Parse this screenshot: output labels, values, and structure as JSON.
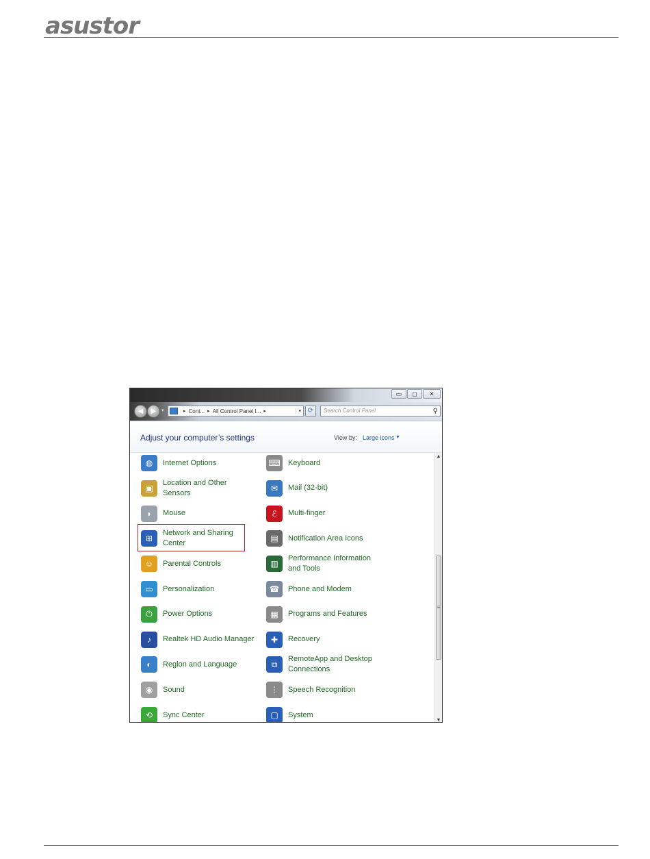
{
  "page": {
    "brand": "asustor"
  },
  "window": {
    "controls": {
      "minimize": "▭",
      "maximize": "◻",
      "close": "✕"
    },
    "toolbar": {
      "back": "◀",
      "forward": "▶",
      "breadcrumb": [
        "Cont...",
        "All Control Panel I..."
      ],
      "search_placeholder": "Search Control Panel"
    },
    "header": {
      "title": "Adjust your computer’s settings",
      "view_by_label": "View by:",
      "view_by_value": "Large icons"
    },
    "items_left": [
      {
        "label": "Internet Options",
        "icon": "internet-options-icon",
        "color": "#3a7cc8"
      },
      {
        "label": "Location and Other\nSensors",
        "icon": "location-sensors-icon",
        "color": "#c9a23a"
      },
      {
        "label": "Mouse",
        "icon": "mouse-icon",
        "color": "#9aa3ad"
      },
      {
        "label": "Network and Sharing\nCenter",
        "icon": "network-sharing-icon",
        "color": "#2a5fb8"
      },
      {
        "label": "Parental Controls",
        "icon": "parental-controls-icon",
        "color": "#e0a020"
      },
      {
        "label": "Personalization",
        "icon": "personalization-icon",
        "color": "#2f8fd0"
      },
      {
        "label": "Power Options",
        "icon": "power-options-icon",
        "color": "#3aa040"
      },
      {
        "label": "Realtek HD Audio Manager",
        "icon": "realtek-audio-icon",
        "color": "#2a4fa0"
      },
      {
        "label": "Region and Language",
        "icon": "region-language-icon",
        "color": "#3a80c8"
      },
      {
        "label": "Sound",
        "icon": "sound-icon",
        "color": "#a0a0a0"
      },
      {
        "label": "Sync Center",
        "icon": "sync-center-icon",
        "color": "#38a838"
      }
    ],
    "items_right": [
      {
        "label": "Keyboard",
        "icon": "keyboard-icon",
        "color": "#8a8a8a"
      },
      {
        "label": "Mail (32-bit)",
        "icon": "mail-icon",
        "color": "#3a78c0"
      },
      {
        "label": "Multi-finger",
        "icon": "multi-finger-icon",
        "color": "#c8141e"
      },
      {
        "label": "Notification Area Icons",
        "icon": "notification-area-icon",
        "color": "#6a6a6a"
      },
      {
        "label": "Performance Information\nand Tools",
        "icon": "performance-info-icon",
        "color": "#2a6a3a"
      },
      {
        "label": "Phone and Modem",
        "icon": "phone-modem-icon",
        "color": "#7a8a9a"
      },
      {
        "label": "Programs and Features",
        "icon": "programs-features-icon",
        "color": "#8a8a8a"
      },
      {
        "label": "Recovery",
        "icon": "recovery-icon",
        "color": "#2a5fb8"
      },
      {
        "label": "RemoteApp and Desktop\nConnections",
        "icon": "remoteapp-icon",
        "color": "#2a5fb8"
      },
      {
        "label": "Speech Recognition",
        "icon": "speech-recognition-icon",
        "color": "#8a8a8a"
      },
      {
        "label": "System",
        "icon": "system-icon",
        "color": "#2a5fb8"
      }
    ]
  }
}
